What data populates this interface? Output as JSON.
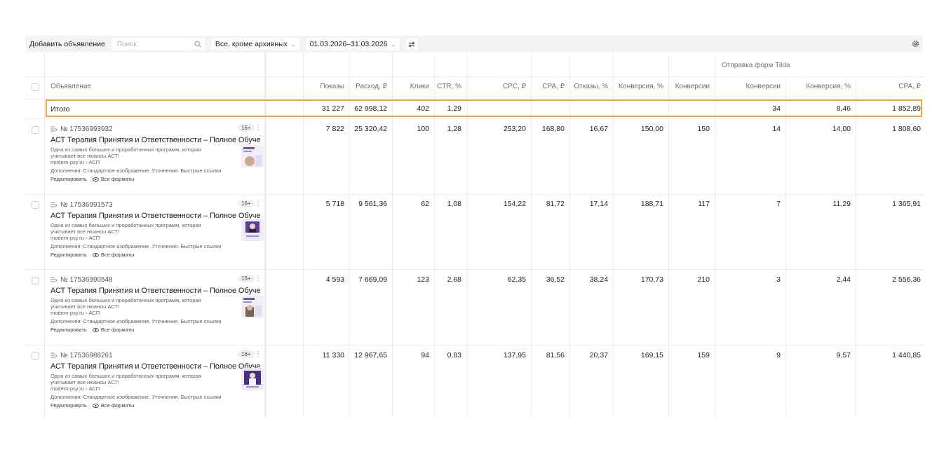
{
  "toolbar": {
    "add_label": "Добавить объявление",
    "search_placeholder": "Поиск",
    "filter_label": "Все, кроме архивных",
    "date_range": "01.03.2026–31.03.2026"
  },
  "table": {
    "group_header": "Отправка форм Tilda",
    "columns": [
      "Объявление",
      "Показы",
      "Расход, ₽",
      "Клики",
      "CTR, %",
      "CPC, ₽",
      "CPA, ₽",
      "Отказы, %",
      "Конверсия, %",
      "Конверсии",
      "Конверсии",
      "Конверсия, %",
      "CPA, ₽"
    ],
    "total": {
      "label": "Итого",
      "values": [
        "31 227",
        "62 998,12",
        "402",
        "1,29",
        "",
        "",
        "",
        "",
        "",
        "34",
        "8,46",
        "1 852,89"
      ]
    },
    "rows": [
      {
        "id": "№ 17536993932",
        "age": "16+",
        "title": "АСТ Терапия Принятия и Ответственности – Полное Обучение – ...",
        "desc": "Одна из самых больших и проработанных программ, которая учитывает все нюансы АСТ!",
        "url": "modern-psy.ru › АСП",
        "extras": "Дополнения: Стандартное изображение. Уточнения. Быстрые ссылки",
        "edit": "Редактировать",
        "formats": "Все форматы",
        "values": [
          "7 822",
          "25 320,42",
          "100",
          "1,28",
          "253,20",
          "168,80",
          "16,67",
          "150,00",
          "150",
          "14",
          "14,00",
          "1 808,60"
        ]
      },
      {
        "id": "№ 17536991573",
        "age": "16+",
        "title": "АСТ Терапия Принятия и Ответственности – Полное Обучение – ...",
        "desc": "Одна из самых больших и проработанных программ, которая учитывает все нюансы АСТ!",
        "url": "modern-psy.ru › АСП",
        "extras": "Дополнения: Стандартное изображение. Уточнения. Быстрые ссылки",
        "edit": "Редактировать",
        "formats": "Все форматы",
        "values": [
          "5 718",
          "9 561,36",
          "62",
          "1,08",
          "154,22",
          "81,72",
          "17,14",
          "188,71",
          "117",
          "7",
          "11,29",
          "1 365,91"
        ]
      },
      {
        "id": "№ 17536990548",
        "age": "16+",
        "title": "АСТ Терапия Принятия и Ответственности – Полное Обучение – ...",
        "desc": "Одна из самых больших и проработанных программ, которая учитывает все нюансы АСТ!",
        "url": "modern-psy.ru › АСП",
        "extras": "Дополнения: Стандартное изображение. Уточнения. Быстрые ссылки",
        "edit": "Редактировать",
        "formats": "Все форматы",
        "values": [
          "4 593",
          "7 669,09",
          "123",
          "2,68",
          "62,35",
          "36,52",
          "38,24",
          "170,73",
          "210",
          "3",
          "2,44",
          "2 556,36"
        ]
      },
      {
        "id": "№ 17536988261",
        "age": "16+",
        "title": "АСТ Терапия Принятия и Ответственности – Полное Обучение – ...",
        "desc": "Одна из самых больших и проработанных программ, которая учитывает все нюансы АСТ!",
        "url": "modern-psy.ru › АСП",
        "extras": "Дополнения: Стандартное изображение. Уточнения. Быстрые ссылки",
        "edit": "Редактировать",
        "formats": "Все форматы",
        "values": [
          "11 330",
          "12 967,65",
          "94",
          "0,83",
          "137,95",
          "81,56",
          "20,37",
          "169,15",
          "159",
          "9",
          "9,57",
          "1 440,85"
        ]
      }
    ]
  },
  "colors": {
    "highlight": "#f2a73b",
    "toolbar_bg": "#f3f4f6",
    "grid_line": "#ececef"
  }
}
